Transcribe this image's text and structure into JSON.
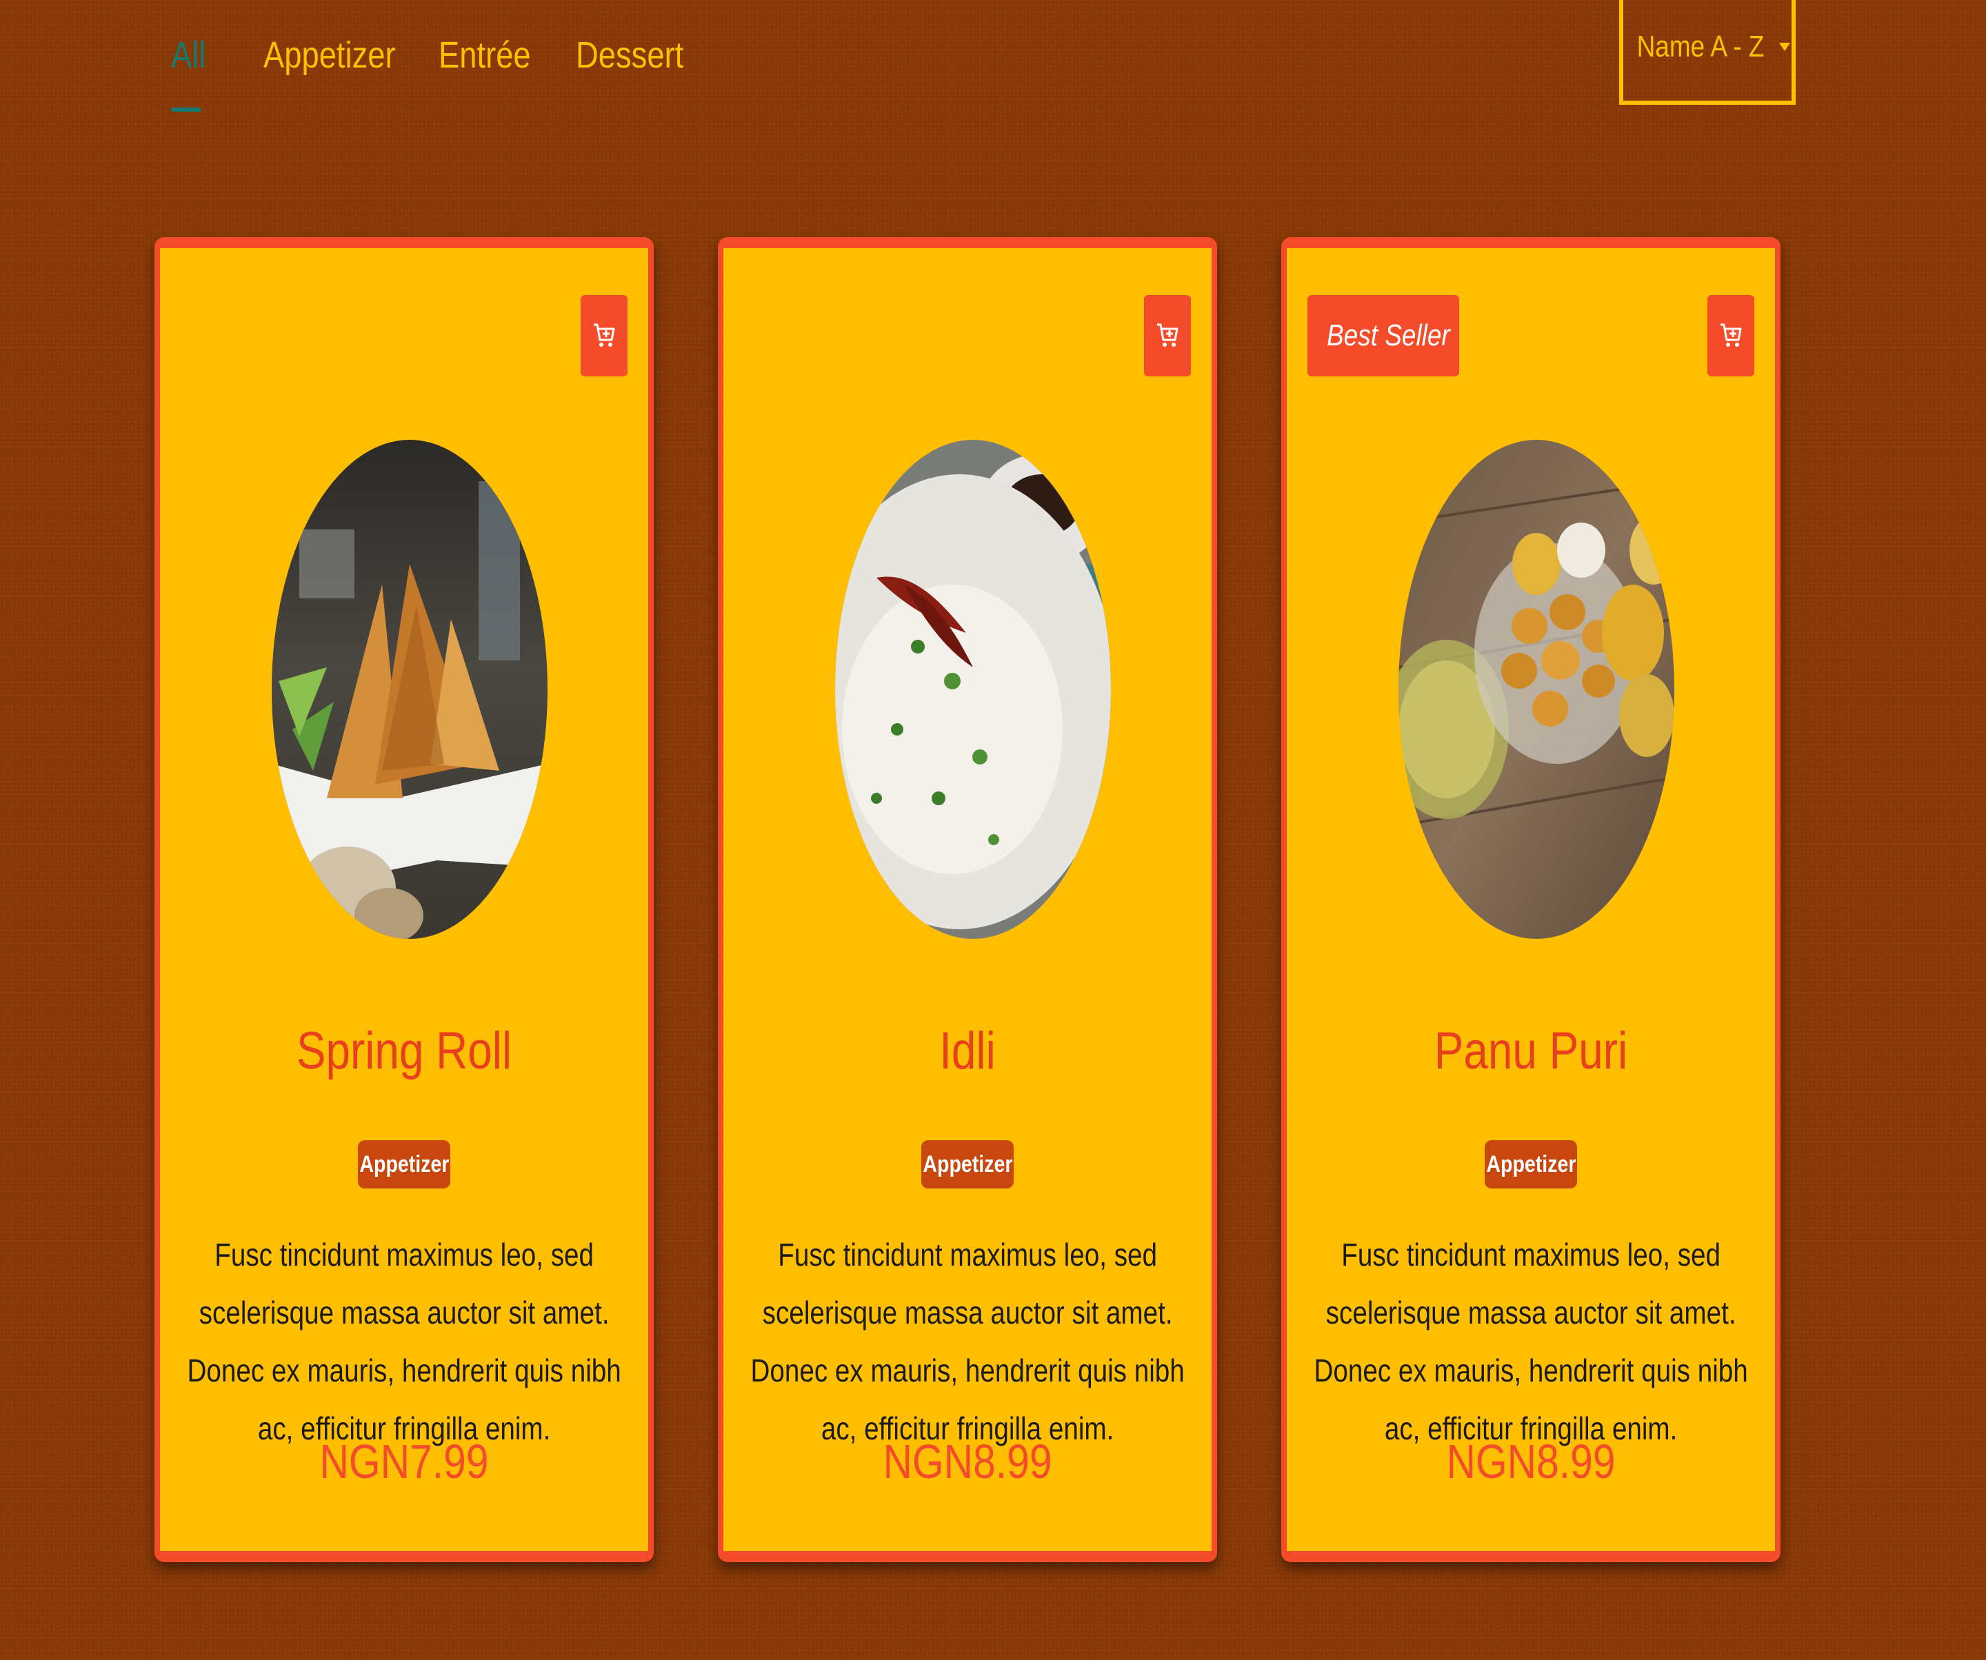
{
  "nav": {
    "tabs": [
      {
        "label": "All",
        "active": true
      },
      {
        "label": "Appetizer",
        "active": false
      },
      {
        "label": "Entrée",
        "active": false
      },
      {
        "label": "Dessert",
        "active": false
      }
    ]
  },
  "sort": {
    "selected": "Name A - Z"
  },
  "cards": [
    {
      "title": "Spring Roll",
      "category": "Appetizer",
      "description": "Fusc tincidunt maximus leo, sed scelerisque massa auctor sit amet. Donec ex mauris, hendrerit quis nibh ac, efficitur fringilla enim.",
      "price": "NGN7.99",
      "best_seller": false,
      "image_icon": "spring-roll-photo"
    },
    {
      "title": "Idli",
      "category": "Appetizer",
      "description": "Fusc tincidunt maximus leo, sed scelerisque massa auctor sit amet. Donec ex mauris, hendrerit quis nibh ac, efficitur fringilla enim.",
      "price": "NGN8.99",
      "best_seller": false,
      "image_icon": "idli-photo"
    },
    {
      "title": "Panu Puri",
      "category": "Appetizer",
      "description": "Fusc tincidunt maximus leo, sed scelerisque massa auctor sit amet. Donec ex mauris, hendrerit quis nibh ac, efficitur fringilla enim.",
      "price": "NGN8.99",
      "best_seller": true,
      "best_seller_label": "Best Seller",
      "image_icon": "panu-puri-photo"
    }
  ],
  "icons": {
    "cart": "cart-plus-icon",
    "star": "star-outline-icon"
  },
  "colors": {
    "background": "#8a3a07",
    "card": "#ffbe00",
    "accent": "#f44b2b",
    "tab_text": "#ffc000",
    "tab_active": "#157a74",
    "badge": "#c8470e"
  }
}
